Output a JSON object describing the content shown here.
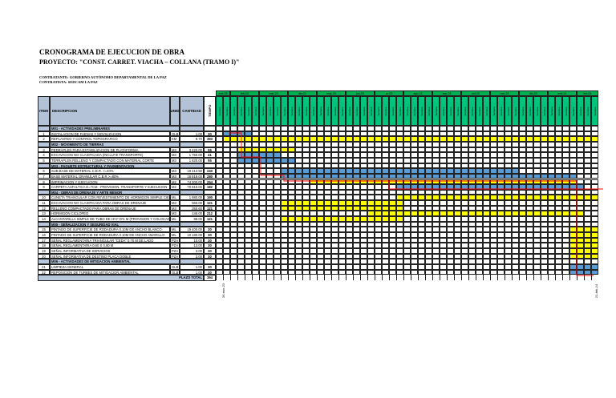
{
  "title": "CRONOGRAMA DE EJECUCION DE OBRA",
  "project": "PROYECTO: \"CONST. CARRET. VIACHA – COLLANA (TRAMO I)\"",
  "contratante": "CONTRATANTE: GOBIERNO AUTÓNOMO DEPARTAMENTAL DE LA PAZ",
  "contratista": "CONTRATISTA: SEDCAM LA PAZ",
  "headers": {
    "item": "ITEM",
    "desc": "DESCRIPCION",
    "unit": "UNID",
    "qty": "CANTIDAD",
    "time": "TIEMPO"
  },
  "week_label": "Semana",
  "months": [
    {
      "label": "ene-23",
      "weeks": 2
    },
    {
      "label": "feb-23",
      "weeks": 4
    },
    {
      "label": "mar-23",
      "weeks": 4
    },
    {
      "label": "abr-23",
      "weeks": 4
    },
    {
      "label": "may-23",
      "weeks": 4
    },
    {
      "label": "jun-23",
      "weeks": 4
    },
    {
      "label": "jul-23",
      "weeks": 4
    },
    {
      "label": "ago-23",
      "weeks": 4
    },
    {
      "label": "sep-23",
      "weeks": 4
    },
    {
      "label": "oct-23",
      "weeks": 4
    },
    {
      "label": "nov-23",
      "weeks": 4
    },
    {
      "label": "dic-23",
      "weeks": 4
    },
    {
      "label": "ene-24",
      "weeks": 4
    },
    {
      "label": "feb-24",
      "weeks": 3
    }
  ],
  "colors": {
    "blue": "#5b9bd5",
    "yellow": "#ffff00",
    "critical": "#ff0000"
  },
  "rows": [
    {
      "type": "group",
      "desc": "M01 - ACTIVIDADES PRELIMINARES"
    },
    {
      "item": "1",
      "desc": "INSTALACION DE FAENAS Y MOVILIZACION",
      "unit": "GLB",
      "qty": "1.00",
      "time": "30",
      "bar": [
        1,
        4
      ],
      "color": "blue"
    },
    {
      "item": "2",
      "desc": "REPLANTEO Y CONTROL TOPOGRAFICO",
      "unit": "KM",
      "qty": "9.70",
      "time": "393",
      "bar": [
        1,
        52
      ],
      "color": "yellow"
    },
    {
      "type": "group",
      "desc": "M02 - MOVIMIENTO DE TIERRAS"
    },
    {
      "item": "3",
      "desc": "PEDRAPLEN PARA ESTABILIZACION DE PLATAFORMA",
      "unit": "M3",
      "qty": "3 420.00",
      "time": "55",
      "bar": [
        3,
        10
      ],
      "color": "yellow"
    },
    {
      "item": "4",
      "desc": "EXCAVACION NO CLASIFICADA (INCLUYE TRANSPORTE)",
      "unit": "M3",
      "qty": "1 750.00",
      "time": "41",
      "bar": [
        3,
        8
      ],
      "color": "blue"
    },
    {
      "item": "5",
      "desc": "TERRAPLEN RELLENO Y COMPACTADO CON MATERIAL CORTE",
      "unit": "M3",
      "qty": "1 820.00",
      "time": "55",
      "bar": [
        3,
        10
      ],
      "color": "blue"
    },
    {
      "type": "group",
      "desc": "M03 - PAQUETE ESTRUCTURAL Y PAVIMENTACION"
    },
    {
      "item": "6",
      "desc": "SUB BASE DE MATERIAL C.B.R. >=40%",
      "unit": "M3",
      "qty": "19 414.50",
      "time": "240",
      "bar": [
        9,
        41
      ],
      "color": "blue"
    },
    {
      "item": "7",
      "desc": "BASE MATERIAL GRANULAR C.B.R.>=80%",
      "unit": "M3",
      "qty": "18 819.00",
      "time": "280",
      "bar": [
        9,
        49
      ],
      "color": "blue"
    },
    {
      "item": "8",
      "desc": "IMPRIMACION Y EJECUCION",
      "unit": "M2",
      "qty": "74 300.00",
      "time": "254",
      "bar": [
        13,
        49
      ],
      "color": "yellow"
    },
    {
      "item": "9",
      "desc": "CARPETA ASFALTICA E=7CM - PROVISION, TRANSPORTE Y EJECUCION",
      "unit": "M2",
      "qty": "70 810.00",
      "time": "182",
      "bar": [
        25,
        50
      ],
      "color": "blue"
    },
    {
      "type": "group",
      "desc": "M04 - OBRAS DE DRENAJE Y ARTE MENOR"
    },
    {
      "item": "10",
      "desc": "CUNETA TRIANGULAR CON REVESTIMIENTO DE HORMIGON SIMPLE CIEGO",
      "unit": "ML",
      "qty": "1 980.00",
      "time": "190",
      "bar": [
        25,
        52
      ],
      "color": "yellow"
    },
    {
      "item": "11",
      "desc": "EXCAVACION NO CLASIFICADA PARA OBRAS DE DRENAJE",
      "unit": "M3",
      "qty": "555.00",
      "time": "121",
      "bar": [
        9,
        25
      ],
      "color": "yellow"
    },
    {
      "item": "12",
      "desc": "RELLENO COMPACTADO PARA OBRAS DE DRENAJE",
      "unit": "M3",
      "qty": "250.60",
      "time": "121",
      "bar": [
        9,
        25
      ],
      "color": "yellow"
    },
    {
      "item": "13",
      "desc": "HORMIGON CICLOPEO",
      "unit": "M3",
      "qty": "146.00",
      "time": "212",
      "bar": [
        21,
        50
      ],
      "color": "yellow"
    },
    {
      "item": "14",
      "desc": "ALCANTARILLA SIMPLE DE TUBO DE HºAº Dº1 M (PROVISION Y COLOCADO)",
      "unit": "ML",
      "qty": "88.00",
      "time": "121",
      "bar": [
        9,
        25
      ],
      "color": "yellow"
    },
    {
      "type": "group",
      "desc": "M05 - SEÑALIZACION Y SEGURIDAD VIAL"
    },
    {
      "item": "15",
      "desc": "PINTADO DE SUPERFICIE DE RODADURA 0.10M DE ANCHO BLANCO",
      "unit": "ML",
      "qty": "19 400.00",
      "time": "30",
      "bar": [
        49,
        52
      ],
      "color": "yellow"
    },
    {
      "item": "16",
      "desc": "PINTADO DE SUPERFICIE DE RODADURA 0.10M DE ANCHO AMARILLO",
      "unit": "ML",
      "qty": "10 180.00",
      "time": "30",
      "bar": [
        49,
        52
      ],
      "color": "yellow"
    },
    {
      "item": "17",
      "desc": "SEÑAL REGLAMENTARIA TRIANGULAR \"CEDA\" 0.75 M DE LADO",
      "unit": "PZA",
      "qty": "10.00",
      "time": "30",
      "bar": [
        49,
        52
      ],
      "color": "yellow"
    },
    {
      "item": "18",
      "desc": "SEÑAL REGLAMENTARIA 0.60 X 0.60 M",
      "unit": "PZA",
      "qty": "13.00",
      "time": "30",
      "bar": [
        49,
        52
      ],
      "color": "yellow"
    },
    {
      "item": "19",
      "desc": "SEÑAL INFORMATIVA DE SERVICIOS",
      "unit": "PZA",
      "qty": "3.00",
      "time": "30",
      "bar": [
        49,
        52
      ],
      "color": "yellow"
    },
    {
      "item": "20",
      "desc": "SEÑAL INFORMATIVA DE DESTINO PLACA DOBLE",
      "unit": "PZA",
      "qty": "3.00",
      "time": "30",
      "bar": [
        49,
        52
      ],
      "color": "yellow"
    },
    {
      "type": "group",
      "desc": "M06 - ACTIVIDADES DE MITIGACION AMBIENTAL"
    },
    {
      "item": "21",
      "desc": "LIMPIEZA GENERAL",
      "unit": "GLB",
      "qty": "1.00",
      "time": "30",
      "bar": [
        49,
        52
      ],
      "color": "blue"
    },
    {
      "item": "22",
      "desc": "REPOSICION DE TURBES DE MITIGACION AMBIENTAL",
      "unit": "GLB",
      "qty": "1.00",
      "time": "30",
      "bar": [
        49,
        52
      ],
      "color": "blue"
    }
  ],
  "total": {
    "label": "PLAZO TOTAL",
    "value": "394"
  },
  "start_date": "26-ene-23",
  "end_date": "21-feb-24"
}
